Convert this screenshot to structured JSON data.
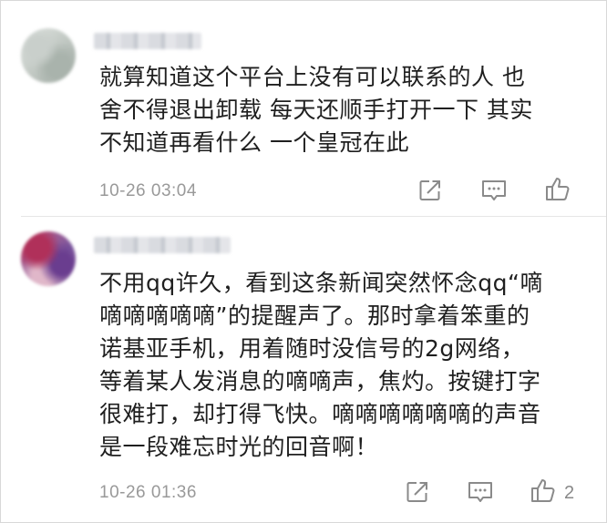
{
  "comments": [
    {
      "lines": [
        "就算知道这个平台上没有可以联系的人  也",
        "舍不得退出卸载  每天还顺手打开一下  其实",
        "不知道再看什么  一个皇冠在此"
      ],
      "timestamp": "10-26 03:04",
      "likes": ""
    },
    {
      "lines": [
        "不用qq许久，看到这条新闻突然怀念qq“嘀",
        "嘀嘀嘀嘀嘀”的提醒声了。那时拿着笨重的",
        "诺基亚手机，用着随时没信号的2g网络，",
        "等着某人发消息的嘀嘀声，焦灼。按键打字",
        "很难打，却打得飞快。嘀嘀嘀嘀嘀嘀的声音",
        "是一段难忘时光的回音啊！"
      ],
      "timestamp": "10-26 01:36",
      "likes": "2"
    }
  ],
  "icons": {
    "share": "share-icon",
    "comment": "comment-bubble-icon",
    "like": "thumbs-up-icon"
  },
  "colors": {
    "text": "#1f1f1f",
    "meta": "#999999",
    "icon": "#8a8a8a"
  }
}
